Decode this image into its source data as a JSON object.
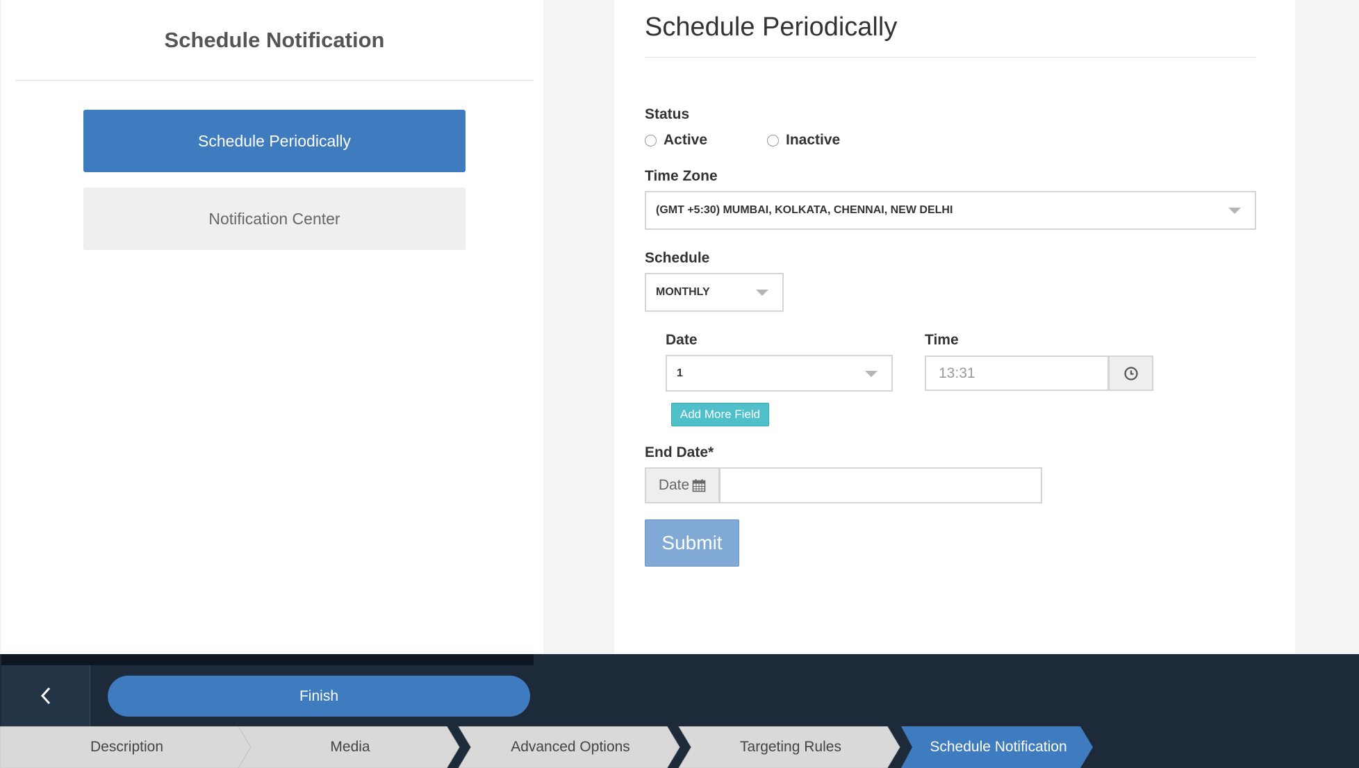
{
  "left": {
    "title": "Schedule Notification",
    "menu": [
      "Schedule Periodically",
      "Notification Center"
    ]
  },
  "form": {
    "title": "Schedule Periodically",
    "status_label": "Status",
    "status_options": [
      "Active",
      "Inactive"
    ],
    "timezone_label": "Time Zone",
    "timezone_value": "(GMT +5:30) MUMBAI, KOLKATA, CHENNAI, NEW DELHI",
    "schedule_label": "Schedule",
    "schedule_value": "MONTHLY",
    "date_label": "Date",
    "date_value": "1",
    "time_label": "Time",
    "time_value": "13:31",
    "add_more_label": "Add More Field",
    "end_date_label": "End Date*",
    "end_date_addon": "Date",
    "submit_label": "Submit"
  },
  "footer": {
    "finish_label": "Finish",
    "steps": [
      "Description",
      "Media",
      "Advanced Options",
      "Targeting Rules",
      "Schedule Notification"
    ],
    "active_step": "Schedule Notification"
  },
  "colors": {
    "primary": "#3f7bbf",
    "submit": "#80a9d6",
    "add_more": "#4fbfc9",
    "footer_bg": "#1d2a3a",
    "step_bg": "#d9d9d9",
    "step_active": "#3f7bbf"
  }
}
